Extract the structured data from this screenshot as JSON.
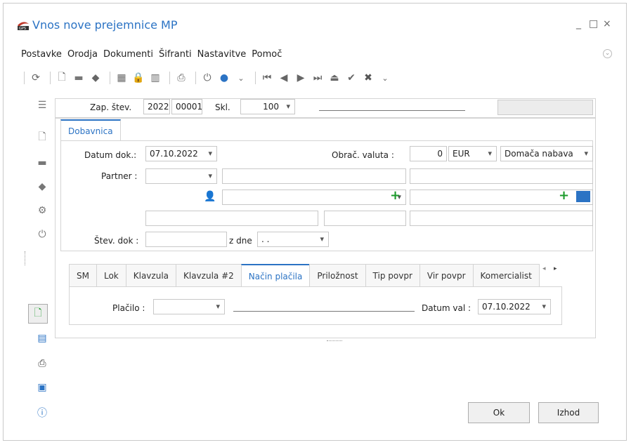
{
  "window": {
    "title": "Vnos nove prejemnice MP",
    "minimize": "_",
    "maximize": "□",
    "close": "×"
  },
  "menu": [
    "Postavke",
    "Orodja",
    "Dokumenti",
    "Šifranti",
    "Nastavitve",
    "Pomoč"
  ],
  "header": {
    "zap_label": "Zap. štev.",
    "zap_year": "2022",
    "zap_number": "00001",
    "skl_label": "Skl.",
    "skl_value": "100"
  },
  "doc_tab": "Dobavnica",
  "form": {
    "datum_label": "Datum dok.:",
    "datum_value": "07.10.2022",
    "valuta_label": "Obrač. valuta :",
    "valuta_amount": "0",
    "valuta_currency": "EUR",
    "nabava_value": "Domača nabava",
    "partner_label": "Partner :",
    "stev_label": "Štev. dok :",
    "zdne_label": "z dne",
    "zdne_value": ". ."
  },
  "subtabs": [
    "SM",
    "Lok",
    "Klavzula",
    "Klavzula #2",
    "Način plačila",
    "Priložnost",
    "Tip povpr",
    "Vir povpr",
    "Komercialist"
  ],
  "active_subtab": "Način plačila",
  "payment": {
    "placilo_label": "Plačilo :",
    "datum_val_label": "Datum val :",
    "datum_val_value": "07.10.2022"
  },
  "buttons": {
    "ok": "Ok",
    "exit": "Izhod"
  },
  "colors": {
    "accent": "#2b73c4",
    "green_plus": "#1a9a2a"
  }
}
